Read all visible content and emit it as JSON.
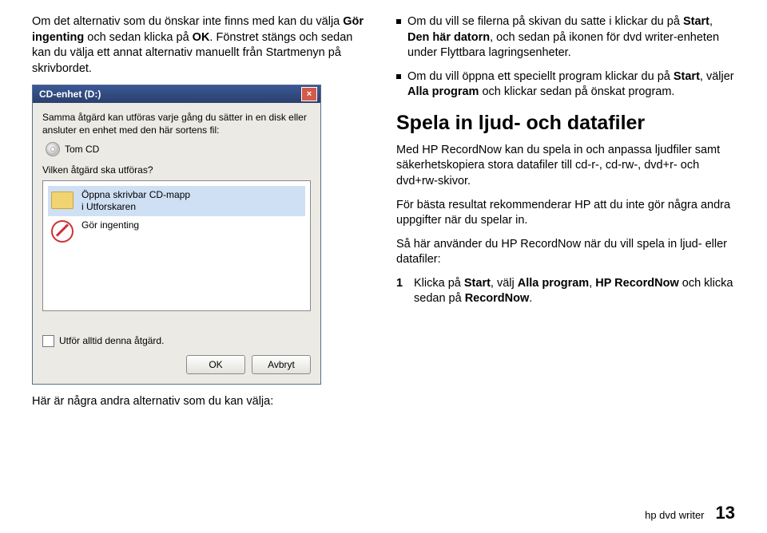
{
  "left": {
    "p1_a": "Om det alternativ som du önskar inte finns med kan du välja ",
    "p1_b": "Gör ingenting",
    "p1_c": " och sedan klicka på ",
    "p1_d": "OK",
    "p1_e": ". Fönstret stängs och sedan kan du välja ett annat alternativ manuellt från Startmenyn på skrivbordet.",
    "caption": "Här är några andra alternativ som du kan välja:"
  },
  "dialog": {
    "title": "CD-enhet (D:)",
    "close": "×",
    "lead": "Samma åtgärd kan utföras varje gång du sätter in en disk eller ansluter en enhet med den här sortens fil:",
    "cdlabel": "Tom CD",
    "prompt": "Vilken åtgärd ska utföras?",
    "item1_line1": "Öppna skrivbar CD-mapp",
    "item1_line2": "i Utforskaren",
    "item2": "Gör ingenting",
    "checkbox": "Utför alltid denna åtgärd.",
    "ok": "OK",
    "cancel": "Avbryt"
  },
  "right": {
    "b1_a": "Om du vill se filerna på skivan du satte i klickar du på ",
    "b1_b": "Start",
    "b1_c": ", ",
    "b1_d": "Den här datorn",
    "b1_e": ", och sedan på ikonen för dvd writer-enheten under Flyttbara lagringsenheter.",
    "b2_a": "Om du vill öppna ett speciellt program klickar du på ",
    "b2_b": "Start",
    "b2_c": ", väljer ",
    "b2_d": "Alla program",
    "b2_e": " och klickar sedan på önskat program.",
    "heading": "Spela in ljud- och datafiler",
    "p1": "Med HP RecordNow kan du spela in och anpassa ljudfiler samt säkerhetskopiera stora datafiler till cd-r-, cd-rw-, dvd+r- och dvd+rw-skivor.",
    "p2": "För bästa resultat rekommenderar HP att du inte gör några andra uppgifter när du spelar in.",
    "p3": "Så här använder du HP RecordNow när du vill spela in ljud- eller datafiler:",
    "step1_a": "Klicka på ",
    "step1_b": "Start",
    "step1_c": ", välj ",
    "step1_d": "Alla program",
    "step1_e": ", ",
    "step1_f": "HP RecordNow",
    "step1_g": " och klicka sedan på ",
    "step1_h": "RecordNow",
    "step1_i": "."
  },
  "footer": {
    "brand": "hp dvd writer",
    "page": "13"
  }
}
